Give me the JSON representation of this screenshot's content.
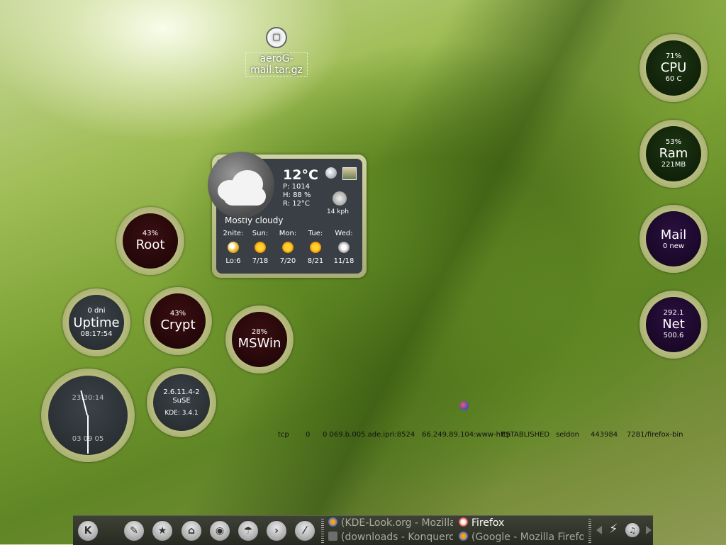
{
  "desktop_icon": {
    "label": "aeroG-mail.tar.gz"
  },
  "meters_right": [
    {
      "pct": "71%",
      "name": "CPU",
      "sub": "60 C"
    },
    {
      "pct": "53%",
      "name": "Ram",
      "sub": "221MB"
    },
    {
      "pct": "",
      "name": "Mail",
      "sub": "0 new"
    },
    {
      "pct": "292.1",
      "name": "Net",
      "sub": "500.6"
    }
  ],
  "meters_left": {
    "root": {
      "pct": "43%",
      "name": "Root"
    },
    "uptime": {
      "top": "0 dni",
      "name": "Uptime",
      "sub": "08:17:54"
    },
    "crypt": {
      "pct": "43%",
      "name": "Crypt"
    },
    "mswin": {
      "pct": "28%",
      "name": "MSWin"
    },
    "clock": {
      "time": "23:30:14",
      "date": "03 09 05"
    },
    "sysinfo": {
      "kernel": "2.6.11.4-2",
      "distro": "SuSE",
      "kde": "KDE: 3.4.1"
    }
  },
  "weather": {
    "temp": "12°C",
    "pressure": "P: 1014",
    "humidity": "H: 88 %",
    "realfeel": "R: 12°C",
    "wind": "14 kph",
    "condition": "Mostly cloudy",
    "forecast": [
      {
        "day": "2nite:",
        "temps": "Lo:6",
        "icon": "night"
      },
      {
        "day": "Sun:",
        "temps": "7/18",
        "icon": "sun"
      },
      {
        "day": "Mon:",
        "temps": "7/20",
        "icon": "sun"
      },
      {
        "day": "Tue:",
        "temps": "8/21",
        "icon": "sun"
      },
      {
        "day": "Wed:",
        "temps": "11/18",
        "icon": "cloudy"
      }
    ]
  },
  "netstat": {
    "proto": "tcp",
    "queue": "0",
    "local": "0 069.b.005.ade.ipri:8524",
    "remote": "66.249.89.104:www-http",
    "state": "ESTABLISHED",
    "user": "seldon",
    "inode": "443984",
    "program": "7281/firefox-bin"
  },
  "taskbar": {
    "kmenu_label": "K",
    "tasks": [
      {
        "label": "(KDE-Look.org - Mozilla",
        "active": false
      },
      {
        "label": "Firefox",
        "active": true
      },
      {
        "label": "(downloads - Konqueror)",
        "active": false
      },
      {
        "label": "(Google - Mozilla Firefox",
        "active": false
      }
    ]
  },
  "colors": {
    "accent_red": "#e03a2e",
    "taskbar_bg": "#2f3328"
  }
}
